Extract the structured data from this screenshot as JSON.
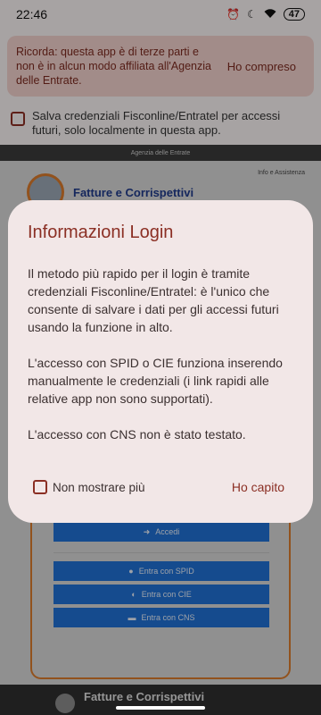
{
  "status_bar": {
    "time": "22:46",
    "battery": "47"
  },
  "disclaimer": {
    "text": "Ricorda: questa app è di terze parti e non è in alcun modo affiliata all'Agenzia delle Entrate.",
    "button": "Ho compreso"
  },
  "save_credentials": {
    "label": "Salva credenziali Fisconline/Entratel per accessi futuri, solo localmente in questa app."
  },
  "webview": {
    "top_label": "Agenzia delle Entrate",
    "title": "Fatture e Corrispettivi",
    "info": "Info e Assistenza",
    "accedi": "Accedi",
    "spid": "Entra con SPID",
    "cie": "Entra con CIE",
    "cns": "Entra con CNS",
    "footer_title": "Fatture e Corrispettivi"
  },
  "dialog": {
    "title": "Informazioni Login",
    "paragraph1": "Il metodo più rapido per il login è tramite credenziali Fisconline/Entratel: è l'unico che consente di salvare i dati per gli accessi futuri usando la funzione in alto.",
    "paragraph2": "L'accesso con SPID o CIE funziona inserendo manualmente le credenziali (i link rapidi alle relative app non sono supportati).",
    "paragraph3": "L'accesso con CNS non è stato testato.",
    "checkbox_label": "Non mostrare più",
    "confirm": "Ho capito"
  }
}
